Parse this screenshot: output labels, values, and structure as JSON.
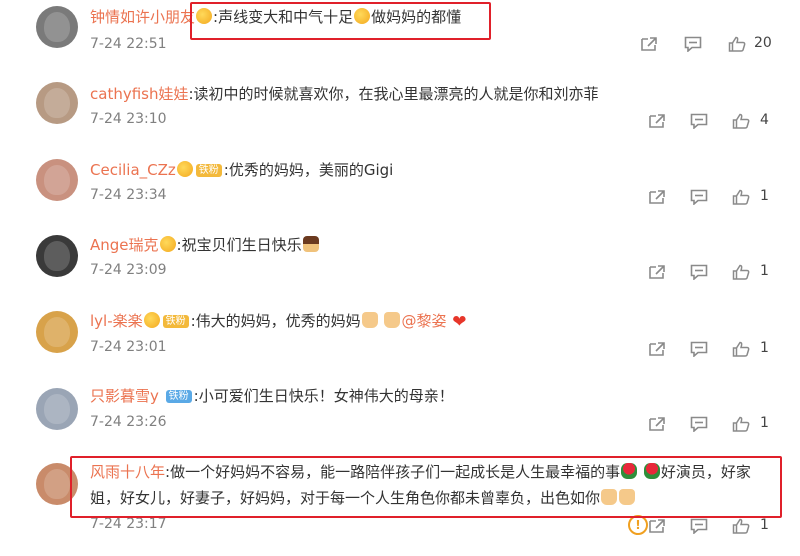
{
  "comments": [
    {
      "username": "钟情如许小朋友",
      "badge": "",
      "text": ":声线变大和中气十足",
      "text2": "做妈妈的都懂",
      "time": "7-24 22:51",
      "likes": "20",
      "avatar_color": "#7a7a7a"
    },
    {
      "username": "cathyfish娃娃",
      "badge": "",
      "text": ":读初中的时候就喜欢你，在我心里最漂亮的人就是你和刘亦菲",
      "time": "7-24 23:10",
      "likes": "4",
      "avatar_color": "#b79a83"
    },
    {
      "username": "Cecilia_CZz",
      "badge": "铁粉",
      "text": ":优秀的妈妈，美丽的Gigi",
      "time": "7-24 23:34",
      "likes": "1",
      "avatar_color": "#c9917f"
    },
    {
      "username": "Ange瑞克",
      "badge": "",
      "text": ":祝宝贝们生日快乐",
      "time": "7-24 23:09",
      "likes": "1",
      "avatar_color": "#3a3a3a"
    },
    {
      "username": "lyl-楽楽",
      "badge": "铁粉",
      "text": ":伟大的妈妈，优秀的妈妈",
      "mention": "@黎姿",
      "time": "7-24 23:01",
      "likes": "1",
      "avatar_color": "#d8a24a"
    },
    {
      "username": "只影暮雪y",
      "badge": "铁粉",
      "text": ":小可爱们生日快乐！女神伟大的母亲！",
      "time": "7-24 23:26",
      "likes": "1",
      "avatar_color": "#9aa5b5"
    },
    {
      "username": "风雨十八年",
      "badge": "",
      "text": ":做一个好妈妈不容易，能一路陪伴孩子们一起成长是人生最幸福的事",
      "text_tail": "好演员，好家",
      "text_line2": "姐，好女儿，好妻子，好妈妈，对于每一个人生角色你都未曾辜负，出色如你",
      "time": "7-24 23:17",
      "likes": "1",
      "avatar_color": "#c98b6a"
    }
  ],
  "colors": {
    "username": "#eb7350",
    "highlight_box": "#e0202a",
    "muted": "#808080"
  }
}
